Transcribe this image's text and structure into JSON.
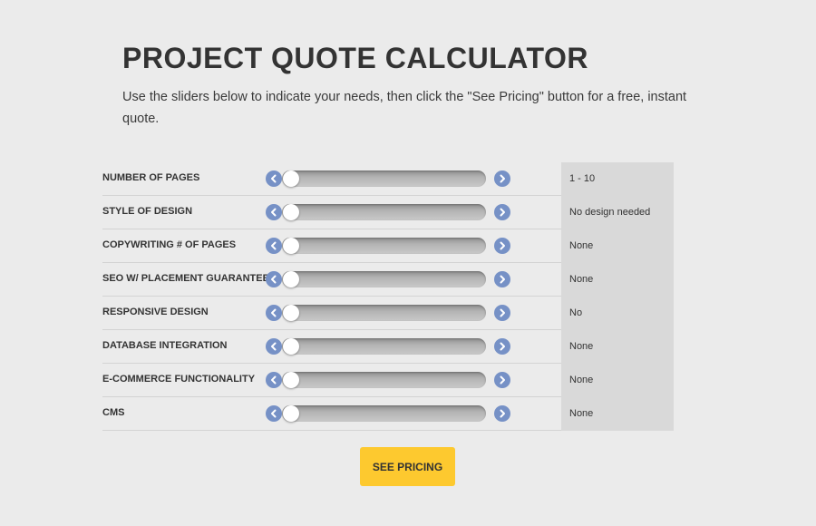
{
  "header": {
    "title": "PROJECT QUOTE CALCULATOR",
    "intro": "Use the sliders below to indicate your needs, then click the \"See Pricing\" button for a free, instant quote."
  },
  "calculator": {
    "rows": [
      {
        "label": "NUMBER OF PAGES",
        "value": "1 - 10",
        "slider_level": 0
      },
      {
        "label": "STYLE OF DESIGN",
        "value": "No design needed",
        "slider_level": 0
      },
      {
        "label": "COPYWRITING # OF PAGES",
        "value": "None",
        "slider_level": 0
      },
      {
        "label": "SEO W/ PLACEMENT GUARANTEE",
        "value": "None",
        "slider_level": 0
      },
      {
        "label": "RESPONSIVE DESIGN",
        "value": "No",
        "slider_level": 0
      },
      {
        "label": "DATABASE INTEGRATION",
        "value": "None",
        "slider_level": 0
      },
      {
        "label": "E-COMMERCE FUNCTIONALITY",
        "value": "None",
        "slider_level": 0
      },
      {
        "label": "CMS",
        "value": "None",
        "slider_level": 0
      }
    ],
    "icons": {
      "decrease": "chevron-left-icon",
      "increase": "chevron-right-icon"
    }
  },
  "actions": {
    "see_pricing_label": "SEE PRICING"
  },
  "colors": {
    "background": "#ebebeb",
    "arrow_button": "#7691c6",
    "result_column": "#d9d9d9",
    "cta_button": "#fdc92f",
    "text": "#333333"
  }
}
